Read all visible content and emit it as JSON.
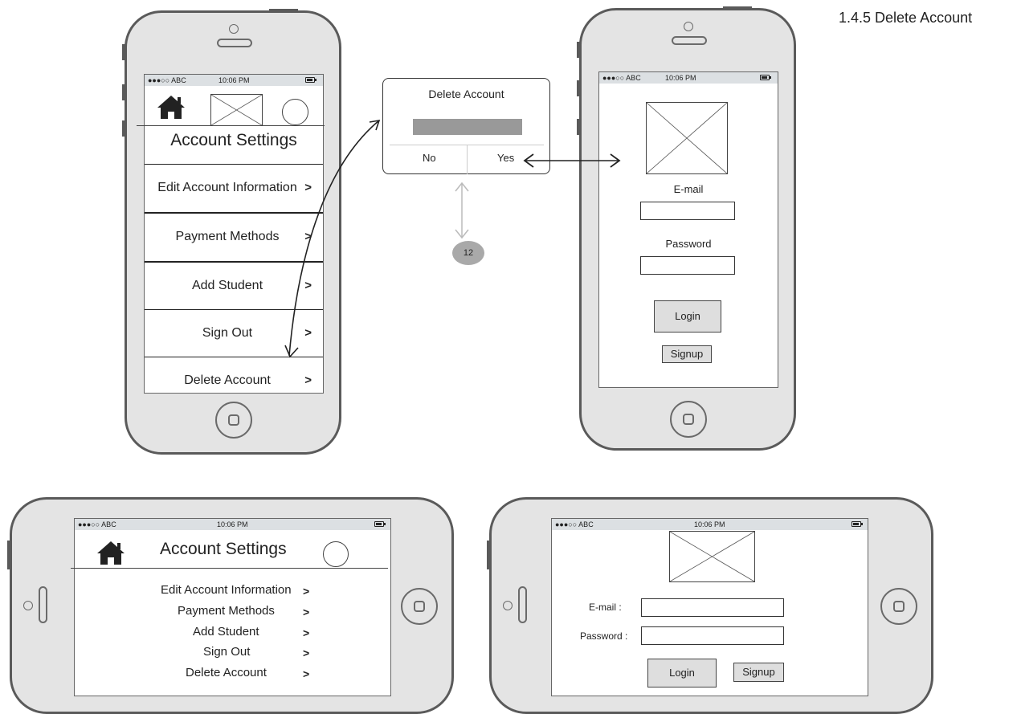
{
  "section_title": "1.4.5 Delete Account",
  "status": {
    "carrier": "●●●○○ ABC",
    "time": "10:06 PM"
  },
  "portrait_settings": {
    "title": "Account Settings",
    "menu": [
      {
        "label": "Edit Account Information",
        "chevron": ">"
      },
      {
        "label": "Payment Methods",
        "chevron": ">"
      },
      {
        "label": "Add Student",
        "chevron": ">"
      },
      {
        "label": "Sign Out",
        "chevron": ">"
      },
      {
        "label": "Delete Account",
        "chevron": ">"
      }
    ]
  },
  "dialog": {
    "title": "Delete Account",
    "no_label": "No",
    "yes_label": "Yes"
  },
  "badge": {
    "value": "12"
  },
  "portrait_login": {
    "email_label": "E-mail",
    "password_label": "Password",
    "login_label": "Login",
    "signup_label": "Signup"
  },
  "landscape_settings": {
    "title": "Account Settings",
    "menu": [
      {
        "label": "Edit Account Information",
        "chevron": ">"
      },
      {
        "label": "Payment Methods",
        "chevron": ">"
      },
      {
        "label": "Add Student",
        "chevron": ">"
      },
      {
        "label": "Sign Out",
        "chevron": ">"
      },
      {
        "label": "Delete Account",
        "chevron": ">"
      }
    ]
  },
  "landscape_login": {
    "email_label": "E-mail :",
    "password_label": "Password :",
    "login_label": "Login",
    "signup_label": "Signup"
  },
  "colors": {
    "phone_body": "#e4e4e4",
    "phone_border": "#5a5a5a",
    "status_bar": "#dce0e3",
    "dialog_bar": "#999999"
  },
  "icons": [
    "house-icon",
    "image-placeholder-icon",
    "profile-circle-icon",
    "chevron-right-icon",
    "battery-icon"
  ]
}
